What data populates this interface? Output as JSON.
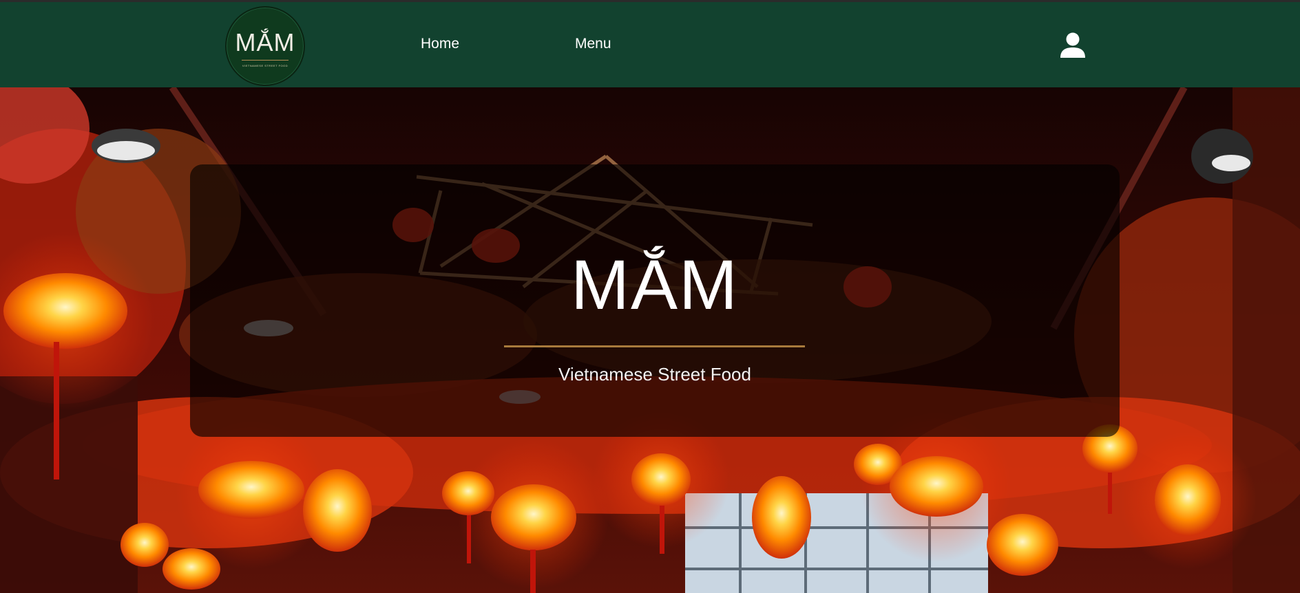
{
  "brand": {
    "logo_text": "MẮM",
    "logo_subtext": "VIETNAMESE STREET FOOD"
  },
  "nav": {
    "links": [
      {
        "label": "Home"
      },
      {
        "label": "Menu"
      }
    ]
  },
  "hero": {
    "title": "MẮM",
    "subtitle": "Vietnamese Street Food"
  },
  "colors": {
    "navbar": "#12422f",
    "accent": "#a87a3c",
    "logo_bg": "#0f3a1e"
  },
  "icons": {
    "account": "user-icon"
  }
}
